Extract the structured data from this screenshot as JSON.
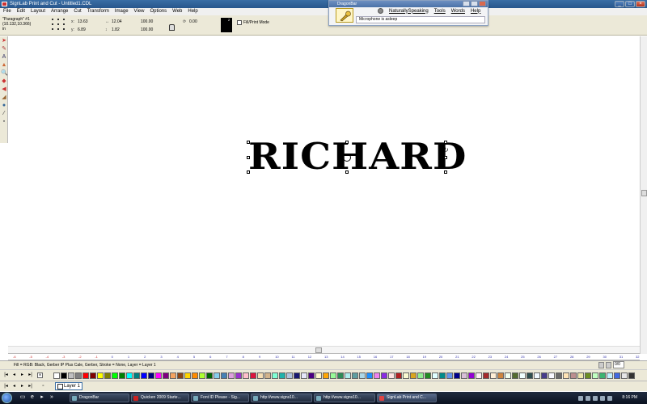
{
  "window": {
    "title": "SignLab Print and Cut - Untitled1.CDL",
    "controls": [
      "_",
      "□",
      "×"
    ]
  },
  "menu": [
    "File",
    "Edit",
    "Layout",
    "Arrange",
    "Cut",
    "Transform",
    "Image",
    "View",
    "Options",
    "Web",
    "Help"
  ],
  "properties": {
    "object_name": "\"Paragraph\" #1",
    "coords": "(10.132,10.366)",
    "units": "in",
    "x": "13.63",
    "y": "6.89",
    "width": "12.04",
    "height": "1.82",
    "scale_x": "100.00",
    "scale_y": "100.00",
    "rotation": "0.00",
    "color_box_label": "2",
    "fill_print_mode": "Fill/Print Mode"
  },
  "dragonbar": {
    "title": "DragonBar",
    "menu": [
      "NaturallySpeaking",
      "Tools",
      "Words",
      "Help"
    ],
    "status": "Microphone is asleep"
  },
  "canvas": {
    "text": "RICHARD"
  },
  "ruler": {
    "ticks": [
      "-6",
      "-5",
      "-4",
      "-3",
      "-2",
      "-1",
      "0",
      "1",
      "2",
      "3",
      "4",
      "5",
      "6",
      "7",
      "8",
      "9",
      "10",
      "11",
      "12",
      "13",
      "14",
      "15",
      "16",
      "17",
      "18",
      "19",
      "20",
      "21",
      "22",
      "23",
      "24",
      "25",
      "26",
      "27",
      "28",
      "29",
      "30",
      "31",
      "32"
    ]
  },
  "statusbar": {
    "text": "Fill = RGB: Black, Gerber IP Plus Cale, Gerber, Stroke = None, Layer = Layer 1",
    "zoom": "0/0"
  },
  "palette": {
    "colors": [
      "#ffffff",
      "#000000",
      "#c0c0c0",
      "#808080",
      "#ff0000",
      "#800000",
      "#ffff00",
      "#808000",
      "#00ff00",
      "#008000",
      "#00ffff",
      "#008080",
      "#0000ff",
      "#000080",
      "#ff00ff",
      "#800080",
      "#f4a460",
      "#8b4513",
      "#ffd700",
      "#ff8c00",
      "#adff2f",
      "#006400",
      "#87ceeb",
      "#4682b4",
      "#dda0dd",
      "#9932cc",
      "#ffc0cb",
      "#dc143c",
      "#f5deb3",
      "#d2b48c",
      "#7fffd4",
      "#20b2aa",
      "#b0c4de",
      "#191970",
      "#e6e6fa",
      "#4b0082",
      "#fffacd",
      "#ffa500",
      "#98fb98",
      "#2e8b57",
      "#afeeee",
      "#5f9ea0",
      "#add8e6",
      "#1e90ff",
      "#ee82ee",
      "#8a2be2",
      "#ffe4e1",
      "#b22222",
      "#fafad2",
      "#daa520",
      "#90ee90",
      "#228b22",
      "#e0ffff",
      "#008b8b",
      "#6495ed",
      "#00008b",
      "#d8bfd8",
      "#9400d3",
      "#fff0f5",
      "#a52a2a",
      "#ffefd5",
      "#cd853f",
      "#f0fff0",
      "#556b2f",
      "#f0ffff",
      "#2f4f4f",
      "#f0f8ff",
      "#483d8b",
      "#f8f8ff",
      "#696969",
      "#ffe4b5",
      "#bc8f8f",
      "#eee8aa",
      "#6b8e23",
      "#c1ffc1",
      "#3cb371",
      "#bfefff",
      "#4169e1",
      "#e6e6e6",
      "#333333"
    ]
  },
  "layer": {
    "name": "Layer 1"
  },
  "taskbar": {
    "buttons": [
      "DragonBar",
      "Quicken 2009 Starte...",
      "Font ID Please - Sig...",
      "http://www.signs10...",
      "http://www.signs10...",
      "SignLab Print and C..."
    ],
    "clock": "8:16 PM"
  }
}
